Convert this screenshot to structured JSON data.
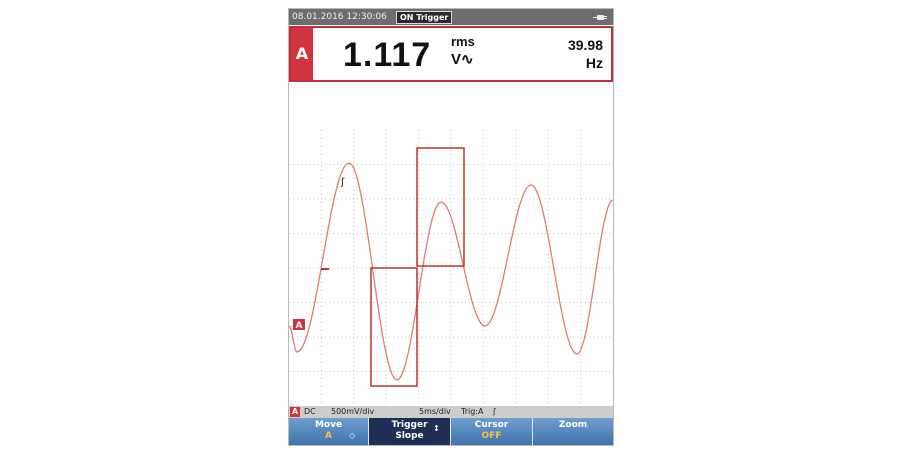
{
  "status": {
    "datetime": "08.01.2016 12:30:06",
    "trigger_state": "ON Trigger",
    "power_icon": "plug-icon"
  },
  "reading": {
    "channel": "A",
    "value": "1.117",
    "unit_top": "rms",
    "unit_bottom": "V∿",
    "frequency": "39.98",
    "frequency_unit": "Hz",
    "accent_color": "#d1343f"
  },
  "plot": {
    "trace_color": "#e07a72",
    "highlight_color": "#b5372d",
    "channel_marker": "A",
    "trigger_marker": "ʃ"
  },
  "infobar": {
    "channel": "A",
    "coupling": "DC",
    "volts_per_div": "500mV/div",
    "time_per_div": "5ms/div",
    "trigger_source": "Trig:A",
    "slope_icon": "ʃ"
  },
  "softkeys": [
    {
      "line1": "Move",
      "line2": "A",
      "glyph": "◇"
    },
    {
      "line1": "Trigger",
      "line2": "Slope",
      "glyph": "↕"
    },
    {
      "line1": "Cursor",
      "line2": "OFF",
      "glyph": ""
    },
    {
      "line1": "Zoom",
      "line2": "",
      "glyph": ""
    }
  ]
}
